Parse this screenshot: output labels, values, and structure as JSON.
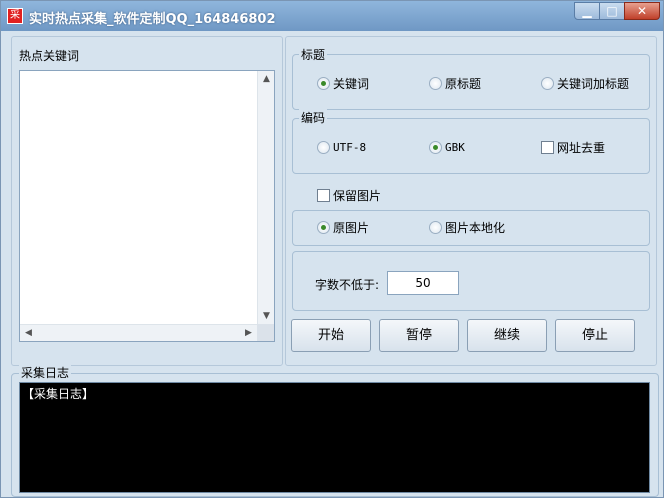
{
  "window": {
    "title": "实时热点采集_软件定制QQ_164846802",
    "icon_glyph": "采",
    "controls": {
      "minimize": "▁",
      "maximize": "□",
      "close": "✕"
    }
  },
  "keywords_panel": {
    "label": "热点关键词",
    "scroll_up": "▲",
    "scroll_down": "▼",
    "scroll_left": "◀",
    "scroll_right": "▶"
  },
  "title_group": {
    "label": "标题",
    "options": [
      {
        "label": "关键词",
        "selected": true
      },
      {
        "label": "原标题",
        "selected": false
      },
      {
        "label": "关键词加标题",
        "selected": false
      }
    ]
  },
  "encoding_group": {
    "label": "编码",
    "options": [
      {
        "label": "UTF-8",
        "selected": false
      },
      {
        "label": "GBK",
        "selected": true
      }
    ],
    "dedupe_label": "网址去重",
    "dedupe_checked": false
  },
  "image_group": {
    "keep_images_label": "保留图片",
    "keep_images_checked": false,
    "options": [
      {
        "label": "原图片",
        "selected": true
      },
      {
        "label": "图片本地化",
        "selected": false
      }
    ]
  },
  "word_count": {
    "label": "字数不低于:",
    "value": "50"
  },
  "buttons": {
    "start": "开始",
    "pause": "暂停",
    "resume": "继续",
    "stop": "停止"
  },
  "log_panel": {
    "label": "采集日志",
    "content": "【采集日志】"
  },
  "colors": {
    "accent": "#3a8a2a",
    "title_bar": "#7aa3cf",
    "log_bg": "#000000"
  }
}
